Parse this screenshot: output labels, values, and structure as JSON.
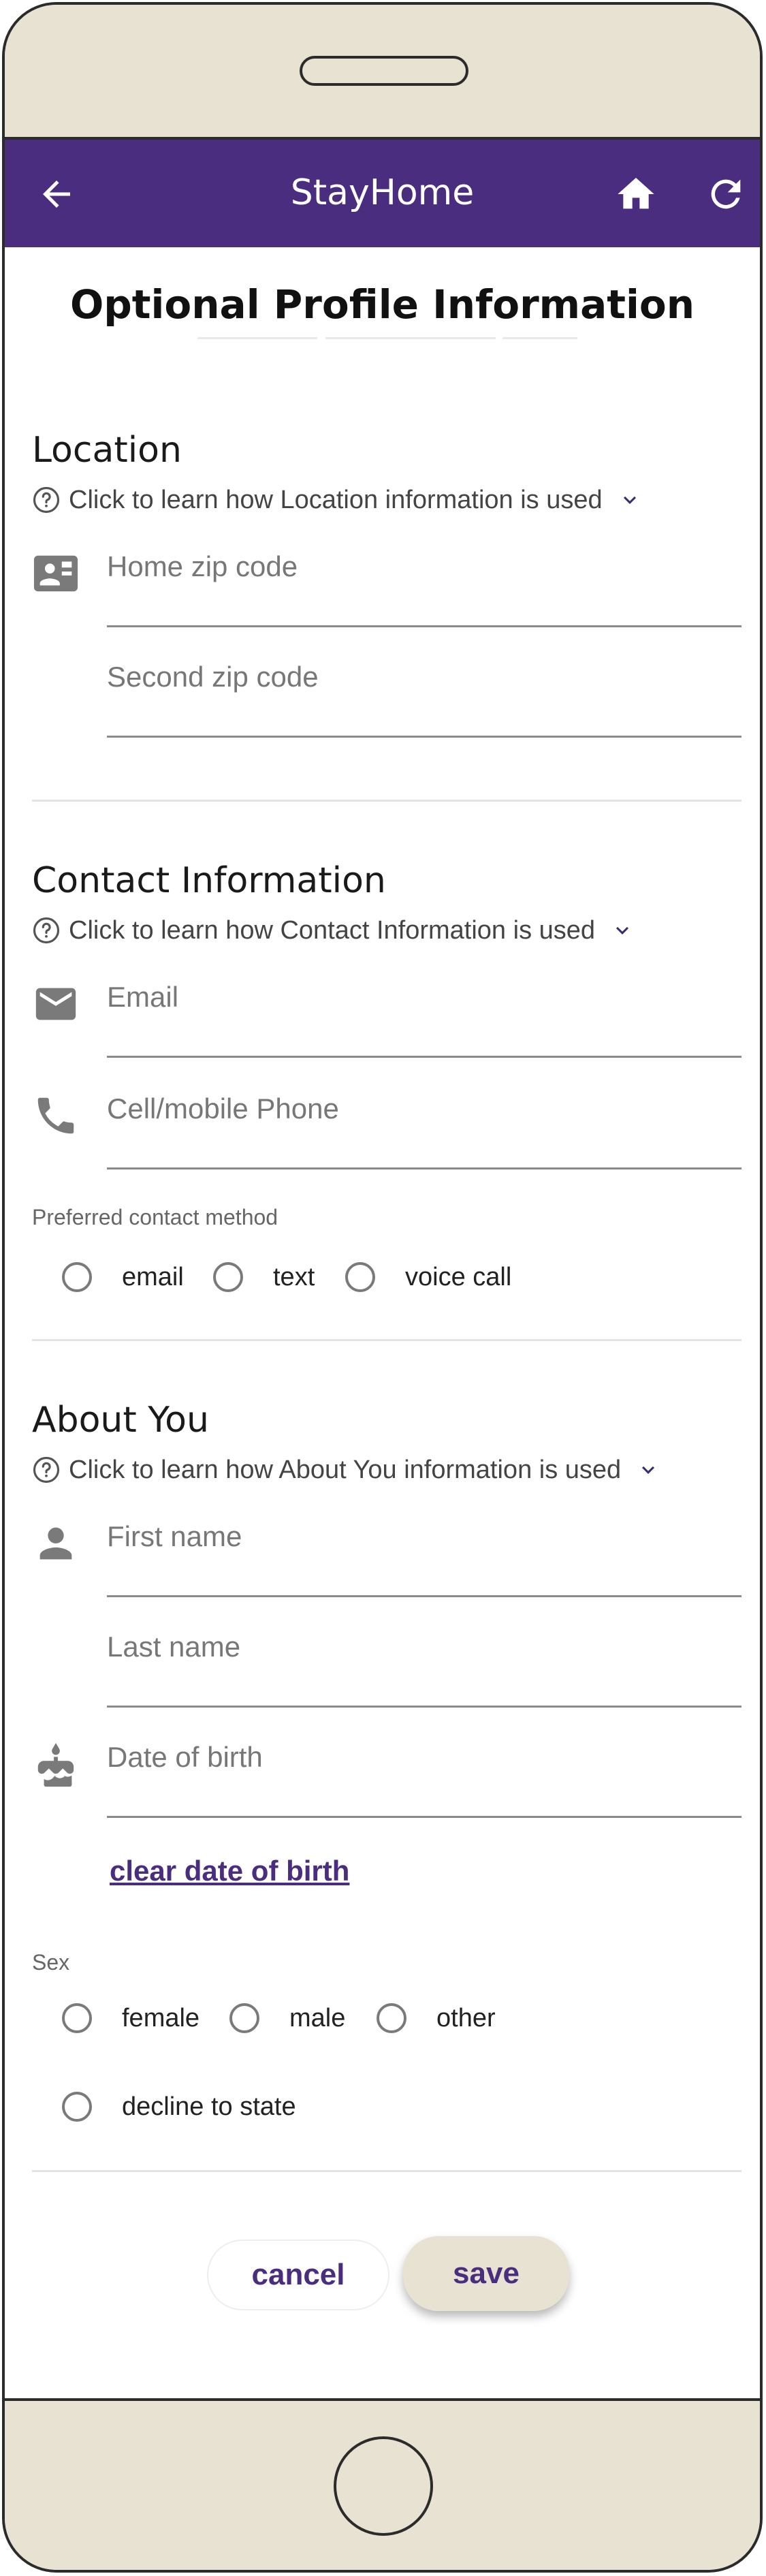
{
  "app": {
    "title": "StayHome"
  },
  "page": {
    "title": "Optional Profile Information"
  },
  "location": {
    "heading": "Location",
    "help": "Click to learn how Location information is used",
    "home_zip_placeholder": "Home zip code",
    "second_zip_placeholder": "Second zip code"
  },
  "contact": {
    "heading": "Contact Information",
    "help": "Click to learn how Contact Information is used",
    "email_placeholder": "Email",
    "phone_placeholder": "Cell/mobile Phone",
    "preferred_label": "Preferred contact method",
    "options": [
      "email",
      "text",
      "voice call"
    ]
  },
  "about": {
    "heading": "About You",
    "help": "Click to learn how About You information is used",
    "first_name_placeholder": "First name",
    "last_name_placeholder": "Last name",
    "dob_placeholder": "Date of birth",
    "clear_dob": "clear date of birth",
    "sex_label": "Sex",
    "sex_options": [
      "female",
      "male",
      "other",
      "decline to state"
    ]
  },
  "actions": {
    "cancel": "cancel",
    "save": "save"
  },
  "colors": {
    "accent": "#4a2d7f",
    "bezel": "#e8e2d3",
    "icon": "#7a7a7a"
  }
}
